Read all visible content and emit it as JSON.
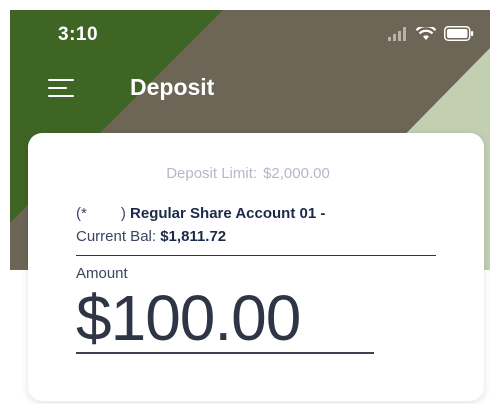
{
  "status_bar": {
    "time": "3:10",
    "icons": [
      "signal-icon",
      "wifi-icon",
      "battery-icon"
    ]
  },
  "nav": {
    "menu_icon": "hamburger-menu-icon",
    "title": "Deposit"
  },
  "card": {
    "deposit_limit_label": "Deposit Limit:",
    "deposit_limit_value": "$2,000.00",
    "account_open_paren": "(*",
    "account_close_paren": ")",
    "account_name": "Regular Share Account 01 -",
    "current_bal_label": "Current Bal:",
    "current_bal_value": "$1,811.72",
    "amount_label": "Amount",
    "amount_value": "$100.00"
  },
  "colors": {
    "header_dark_green": "#3f6525",
    "header_taupe": "#6d6656",
    "header_sage": "#c3cfb1",
    "text_navy": "#1c2a4a",
    "text_muted": "#b6b7c9"
  }
}
